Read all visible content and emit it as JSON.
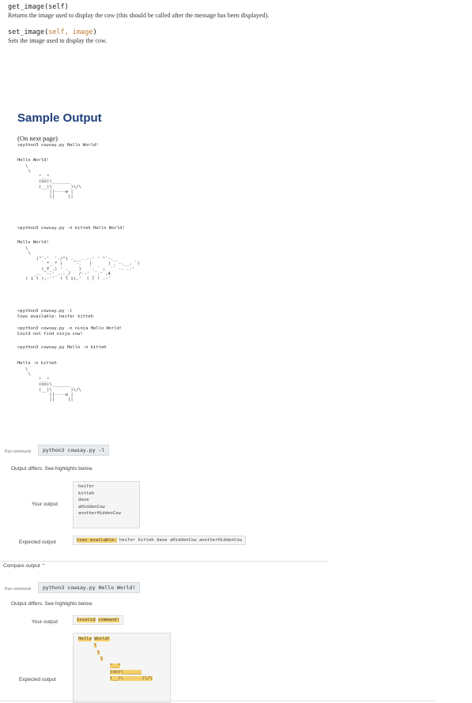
{
  "methods": [
    {
      "name": "get_image",
      "signature": "(self)",
      "description": "Returns the image used to display the cow (this should be called after the message has been displayed)."
    },
    {
      "name": "set_image",
      "open": "(",
      "params": "self, image",
      "close": ")",
      "description": "Sets the image used to display the cow."
    }
  ],
  "sample": {
    "title": "Sample Output",
    "note": "(On next page)",
    "cmd1": ">python3 cowsay.py Hello World!",
    "out1_msg": "Hello World!",
    "cow_ascii": "   \\\n    \\\n        ^__^\n        (oo)\\_______\n        (__)\\       )\\/\\\n            ||----w |\n            ||     ||",
    "cmd2": ">python3 cowsay.py -n kitteh Hello World!",
    "out2_msg": "Hello World!",
    "kitteh_ascii": "   \\\n    \\\n       (\"`-'  '-/\") .___..--' ' \"`-._\n         ` *_ * )    `-.   (      ) .`-.__. `)\n         (_Y_.) ' ._   )   `._` ;  `` -. .-'\n      _.. `--'_..-_/   /--' _ .' ,4\n   ( i l ),-''  ( l i),'  ( ( ! .-'",
    "cmd3": ">python3 cowsay.py -l",
    "out3": "Cows available: heifer kitteh",
    "cmd4": ">python3 cowsay.py -n ninja Hello World!",
    "out4": "Could not find ninja cow!",
    "cmd5": ">python3 cowsay.py Hello -n kitteh",
    "out5_msg": "Hello -n kitteh",
    "cow_ascii2": "   \\\n    \\\n        ^__^\n        (oo)\\_______\n        (__)\\       )\\/\\\n            ||----w |\n            ||     ||"
  },
  "test1": {
    "run_label": "Run command:",
    "command": "python3 cowsay.py -l",
    "status": "Output differs. See highlights below.",
    "your_output_label": "Your output",
    "your_output_lines": [
      "heifer",
      "kitteh",
      "dave",
      "aHiddenCow",
      "anotherHiddenCow"
    ],
    "expected_label": "Expected output",
    "expected_hl": "Cows available:",
    "expected_rest": " heifer kitteh dave aHiddenCow anotherHiddenCow",
    "compare_label": "Compare output"
  },
  "test2": {
    "run_label": "Run command:",
    "command": "python3 cowsay.py Hello World!",
    "status": "Output differs. See highlights below.",
    "your_output_label": "Your output",
    "your_hl1": "Invalid",
    "your_hl2": "command!",
    "expected_label": "Expected output",
    "exp_hello": "Hello",
    "exp_world": "World!",
    "exp_slash1": "\\",
    "exp_slash2": "\\",
    "exp_slash3": "\\",
    "exp_ears": "^__^",
    "exp_face": "(oo)\\",
    "exp_body": "(__)\\",
    "exp_legs": ")\\/\\"
  },
  "colors": {
    "accent_title": "#1f3f7a",
    "highlight": "#f4cf6a",
    "param": "#c07a30"
  }
}
